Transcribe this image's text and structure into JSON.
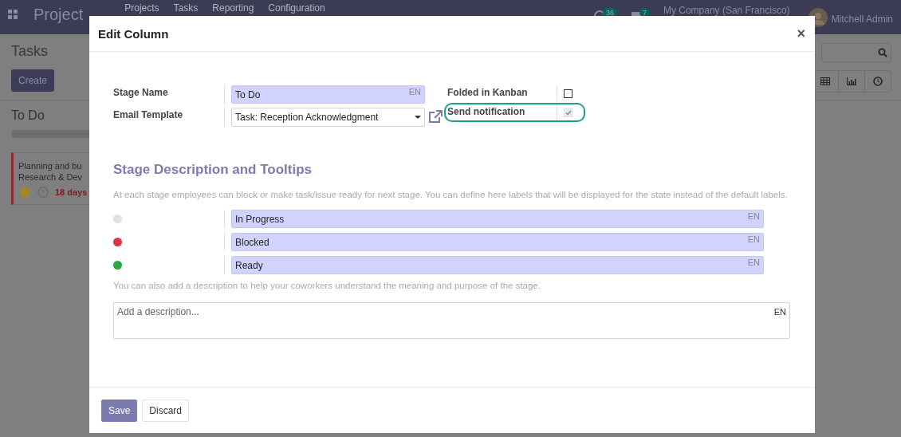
{
  "top_bar": {
    "app_name": "Project",
    "menu": [
      "Projects",
      "Tasks",
      "Reporting",
      "Configuration"
    ],
    "activity_count": "36",
    "message_count": "7",
    "company": "My Company (San Francisco)",
    "user": "Mitchell Admin"
  },
  "background": {
    "title": "Tasks",
    "create_button": "Create",
    "column_title": "To Do",
    "progress": {
      "level": 0
    },
    "card": {
      "lines": [
        "Planning and bu",
        "Research & Dev"
      ],
      "starred": true,
      "deadline": "18 days"
    }
  },
  "dialog": {
    "title": "Edit Column",
    "close": "×",
    "stage_name": {
      "label": "Stage Name",
      "value": "To Do",
      "lang": "EN"
    },
    "email_template": {
      "label": "Email Template",
      "value": "Task: Reception Acknowledgment"
    },
    "folded": {
      "label": "Folded in Kanban",
      "checked": false
    },
    "send_notification": {
      "label": "Send notification",
      "checked": true,
      "focused": true
    },
    "section_title": "Stage Description and Tooltips",
    "section_help": "At each stage employees can block or make task/issue ready for next stage. You can define here labels that will be displayed for the state instead of the default labels.",
    "legends": [
      {
        "color": "#dee2e6",
        "value": "In Progress",
        "lang": "EN"
      },
      {
        "color": "#dc3545",
        "value": "Blocked",
        "lang": "EN"
      },
      {
        "color": "#28a745",
        "value": "Ready",
        "lang": "EN"
      }
    ],
    "description_help": "You can also add a description to help your coworkers understand the meaning and purpose of the stage.",
    "description": {
      "placeholder": "Add a description...",
      "lang": "EN"
    },
    "buttons": [
      "Save",
      "Discard"
    ]
  }
}
